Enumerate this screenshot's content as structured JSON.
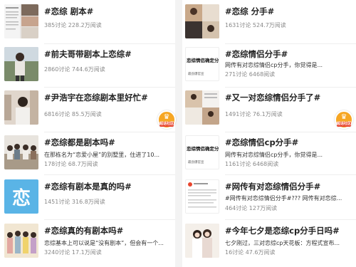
{
  "left": [
    {
      "title": "#恋综 剧本#",
      "stats": "385讨论 228.2万阅读",
      "sub": ""
    },
    {
      "title": "#前夫哥带剧本上恋综#",
      "stats": "2860讨论 744.6万阅读",
      "sub": ""
    },
    {
      "title": "#尹浩宇在恋综剧本里好忙#",
      "stats": "6816讨论 85.5万阅读",
      "sub": ""
    },
    {
      "title": "#恋综都是剧本吗#",
      "sub": "在那栋名为“恋爱小屋”的别墅里，住进了10...",
      "stats": "178讨论 68.7万阅读"
    },
    {
      "title": "#恋综有剧本是真的吗#",
      "stats": "1451讨论 316.8万阅读",
      "sub": ""
    },
    {
      "title": "#恋综真的有剧本吗#",
      "sub": "恋综基本上可以说是“没有剧本”，但会有一个...",
      "stats": "3240讨论 17.1万阅读"
    }
  ],
  "right": [
    {
      "title": "#恋综 分手#",
      "stats": "1631讨论 524.7万阅读",
      "sub": ""
    },
    {
      "title": "#恋综情侣分手#",
      "sub": "网传有对恋综情侣cp分手，你觉得是...",
      "stats": "271讨论 6468阅读"
    },
    {
      "title": "#又一对恋综情侣分手了#",
      "stats": "1491讨论 76.1万阅读",
      "sub": ""
    },
    {
      "title": "#恋综情侣cp分手#",
      "sub": "网传有对恋综情侣cp分手，你觉得是...",
      "stats": "1161讨论 6468阅读"
    },
    {
      "title": "#网传有对恋综情侣分手#",
      "sub": "#网传有对恋综情侣分手#??? 网传有对恋综...",
      "stats": "464讨论 127万阅读"
    },
    {
      "title": "#今年七夕是恋综cp分手日吗#",
      "sub": "七夕刚过，三对恋综cp天花板：方程式宣布...",
      "stats": "16讨论 47.6万阅读"
    }
  ],
  "thumb_text": {
    "r1": "恋综情侣确定分",
    "r1_sub": "最劲爆官宣",
    "r3": "恋综情侣确定分",
    "r3_sub": "最劲爆官宣",
    "l4": "恋"
  },
  "badge": {
    "label": "超话社区"
  },
  "colors": {
    "stats": "#888888",
    "title": "#222222",
    "badge": "#f6a623"
  }
}
